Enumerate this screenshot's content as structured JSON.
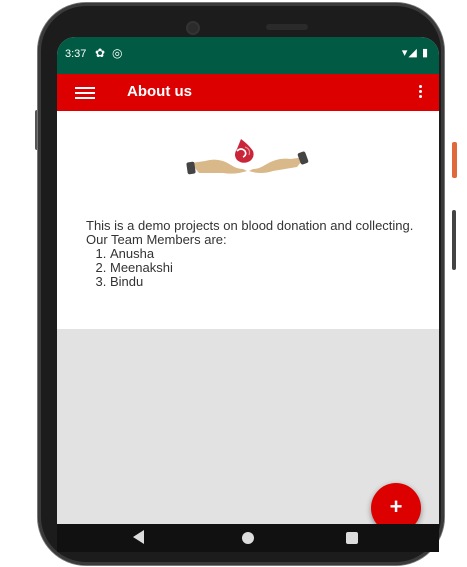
{
  "status_bar": {
    "time": "3:37",
    "gear_icon": "gear-icon",
    "sync_icon": "sync-icon",
    "signal_icons": "▾◢ ▮"
  },
  "app_bar": {
    "title": "About us",
    "menu_icon": "hamburger-menu-icon",
    "overflow_icon": "more-vertical-icon",
    "color": "#dd0000"
  },
  "content": {
    "logo_icon": "blood-donation-hands-icon",
    "intro": "This is a demo projects on blood donation and collecting. Our Team Members are:",
    "members": [
      "Anusha",
      "Meenakshi",
      "Bindu"
    ]
  },
  "fab": {
    "label": "+",
    "color": "#dd0000"
  },
  "nav_bar": {
    "back_icon": "back-triangle-icon",
    "home_icon": "home-circle-icon",
    "recent_icon": "recent-apps-square-icon"
  },
  "colors": {
    "status_bar": "#005a44",
    "screen_background": "#e2e2e2"
  }
}
